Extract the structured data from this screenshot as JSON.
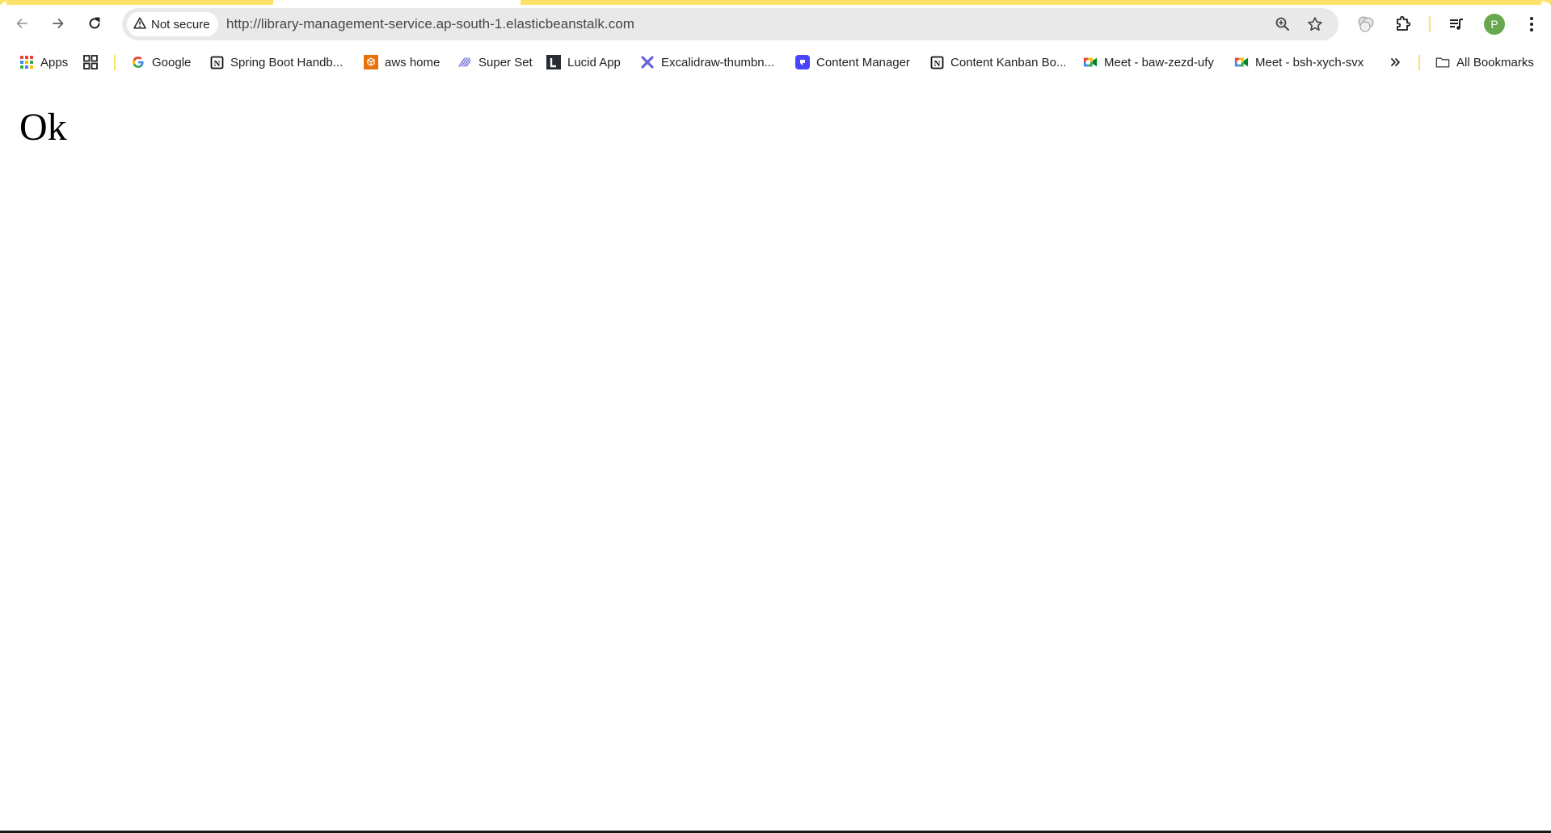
{
  "browser": {
    "active_tab_color": "#ffffff",
    "frame_color": "#fde26a",
    "toolbar": {
      "back_icon": "arrow-left-icon",
      "forward_icon": "arrow-right-icon",
      "reload_icon": "reload-icon",
      "security_label": "Not secure",
      "security_icon": "warning-triangle-icon",
      "url": "http://library-management-service.ap-south-1.elasticbeanstalk.com",
      "zoom_icon": "zoom-in-icon",
      "bookmark_star_icon": "star-icon",
      "extension_icons": [
        "extension-blob-icon",
        "puzzle-icon"
      ],
      "media_icon": "media-playlist-icon",
      "profile_initial": "P",
      "profile_color": "#6aa84f",
      "menu_icon": "kebab-menu-icon"
    },
    "bookmarks_bar": {
      "items": [
        {
          "label": "Apps",
          "icon": "apps-grid-icon"
        },
        {
          "label": "",
          "icon": "tab-groups-icon"
        },
        {
          "label": "Google",
          "icon": "google-icon"
        },
        {
          "label": "Spring Boot Handb...",
          "icon": "notion-icon"
        },
        {
          "label": "aws home",
          "icon": "aws-icon"
        },
        {
          "label": "Super Set",
          "icon": "superset-icon"
        },
        {
          "label": "Lucid App",
          "icon": "lucid-icon"
        },
        {
          "label": "Excalidraw-thumbn...",
          "icon": "excalidraw-icon"
        },
        {
          "label": "Content Manager",
          "icon": "content-manager-icon"
        },
        {
          "label": "Content Kanban Bo...",
          "icon": "notion-icon"
        },
        {
          "label": "Meet - baw-zezd-ufy",
          "icon": "google-meet-icon"
        },
        {
          "label": "Meet - bsh-xych-svx",
          "icon": "google-meet-icon"
        }
      ],
      "overflow_icon": "chevron-double-right-icon",
      "all_bookmarks_label": "All Bookmarks",
      "all_bookmarks_icon": "folder-icon"
    }
  },
  "page": {
    "body_text": "Ok"
  }
}
